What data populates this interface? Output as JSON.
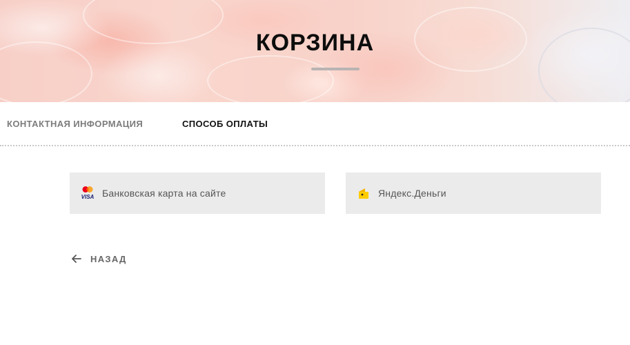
{
  "header": {
    "title": "КОРЗИНА"
  },
  "steps": [
    {
      "label": "КОНТАКТНАЯ ИНФОРМАЦИЯ",
      "active": false
    },
    {
      "label": "СПОСОБ ОПЛАТЫ",
      "active": true
    }
  ],
  "payment_methods": [
    {
      "label": "Банковская карта на сайте",
      "icon": "mastercard-visa-icon"
    },
    {
      "label": "Яндекс.Деньги",
      "icon": "yandex-money-icon"
    }
  ],
  "back": {
    "label": "НАЗАД",
    "icon": "arrow-left-icon"
  },
  "colors": {
    "panel_bg": "#ebebeb",
    "text_dark": "#111111",
    "text_muted": "#7c7c7c",
    "mastercard_red": "#eb001b",
    "mastercard_orange": "#f79e1b",
    "visa_blue": "#1a1f71",
    "yandex_yellow": "#ffcc00"
  }
}
